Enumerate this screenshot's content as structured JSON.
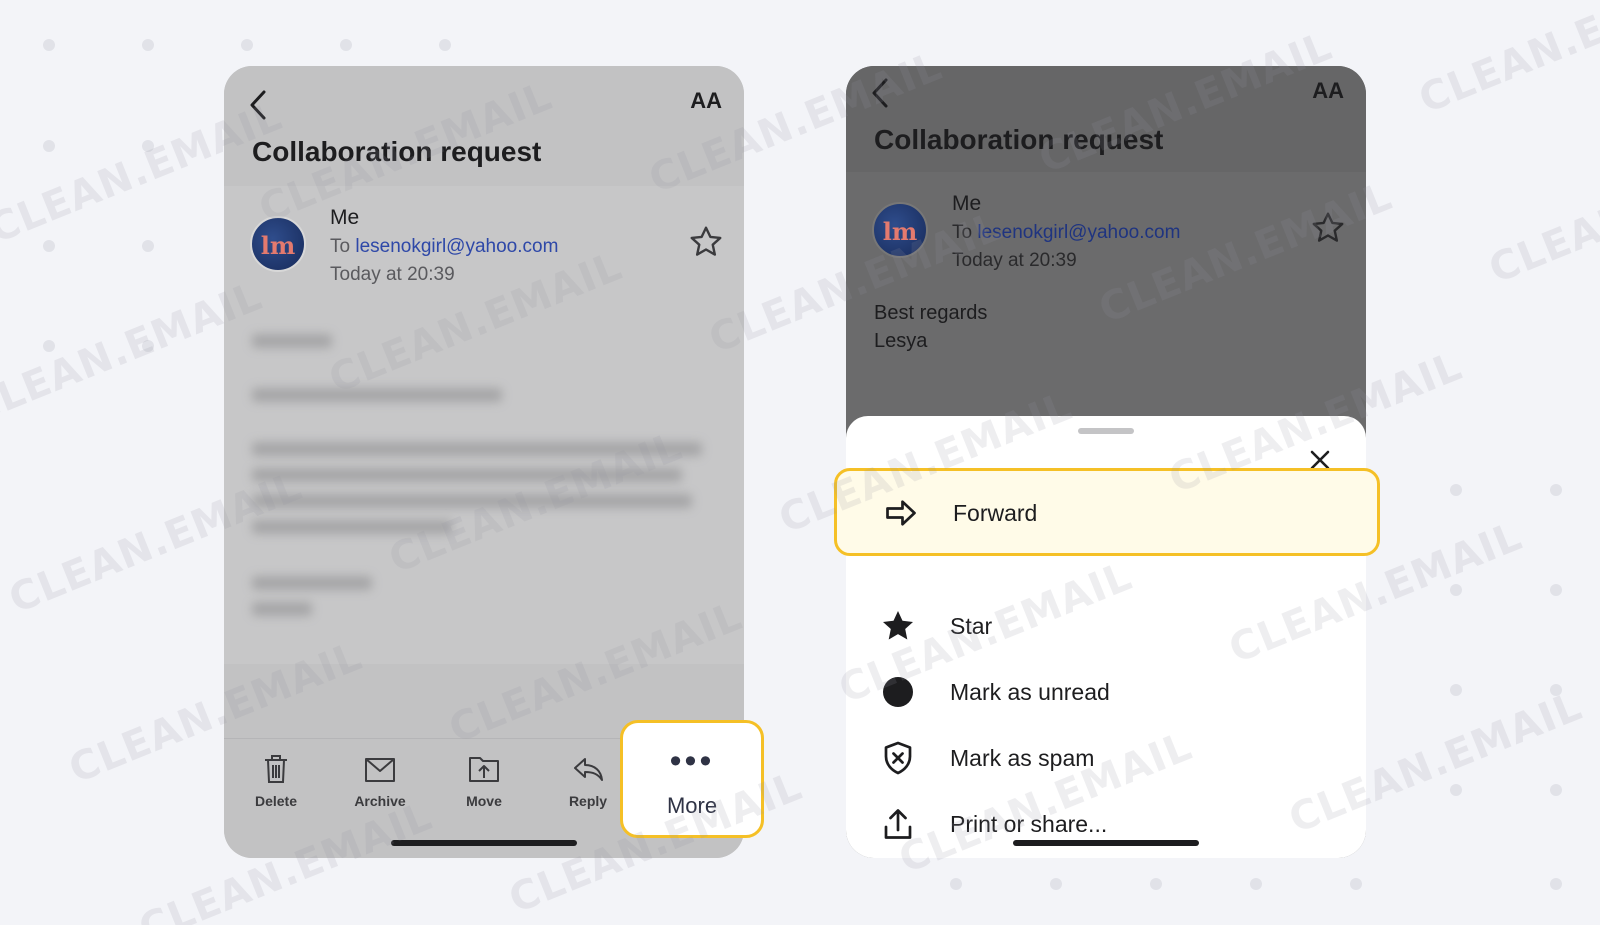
{
  "email": {
    "subject": "Collaboration request",
    "sender": "Me",
    "to_prefix": "To",
    "to_address": "lesenokgirl@yahoo.com",
    "date": "Today at 20:39",
    "signoff": "Best regards",
    "signature": "Lesya",
    "avatar_initials": "lm"
  },
  "reader": {
    "text_size_label": "AA"
  },
  "toolbar": {
    "delete": "Delete",
    "archive": "Archive",
    "move": "Move",
    "reply": "Reply",
    "more": "More"
  },
  "more_menu": {
    "items": [
      {
        "label": "Forward",
        "icon": "forward-arrow-icon"
      },
      {
        "label": "Star",
        "icon": "star-filled-icon"
      },
      {
        "label": "Mark as unread",
        "icon": "unread-dot-icon"
      },
      {
        "label": "Mark as spam",
        "icon": "spam-shield-icon"
      },
      {
        "label": "Print or share...",
        "icon": "share-icon"
      }
    ]
  },
  "watermark": "CLEAN.EMAIL",
  "colors": {
    "highlight_border": "#f5c026",
    "highlight_fill": "#fffbe8",
    "link": "#2e48a8",
    "page_bg": "#f3f4f8"
  }
}
